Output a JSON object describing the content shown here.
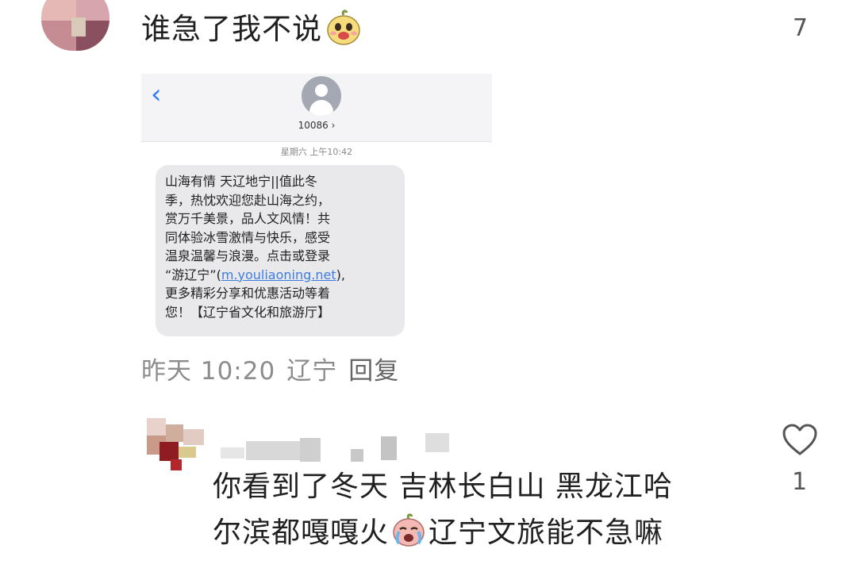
{
  "comment": {
    "text": "谁急了我不说",
    "emoji": "grinning-pear-sticker-icon",
    "like_count": "7"
  },
  "sms": {
    "back_icon": "chevron-left-icon",
    "contact": "10086 ›",
    "timestamp": "星期六 上午10:42",
    "body_lines": [
      "山海有情 天辽地宁||值此冬",
      "季，热忱欢迎您赴山海之约，",
      "赏万千美景，品人文风情！共",
      "同体验冰雪激情与快乐，感受",
      "温泉温馨与浪漫。点击或登录"
    ],
    "link_prefix": "“游辽宁”(",
    "link_text": "m.youliaoning.net",
    "link_suffix": "),",
    "body_lines_after": [
      "更多精彩分享和优惠活动等着",
      "您！【辽宁省文化和旅游厅】"
    ]
  },
  "meta": {
    "time": "昨天 10:20",
    "location": "辽宁",
    "reply": "回复"
  },
  "reply": {
    "line1": "你看到了冬天  吉林长白山  黑龙江哈",
    "line2_before": "尔滨都嘎嘎火",
    "emoji": "crying-pear-sticker-icon",
    "line2_after": "辽宁文旅能不急嘛",
    "like_icon": "heart-outline-icon",
    "like_count": "1"
  }
}
